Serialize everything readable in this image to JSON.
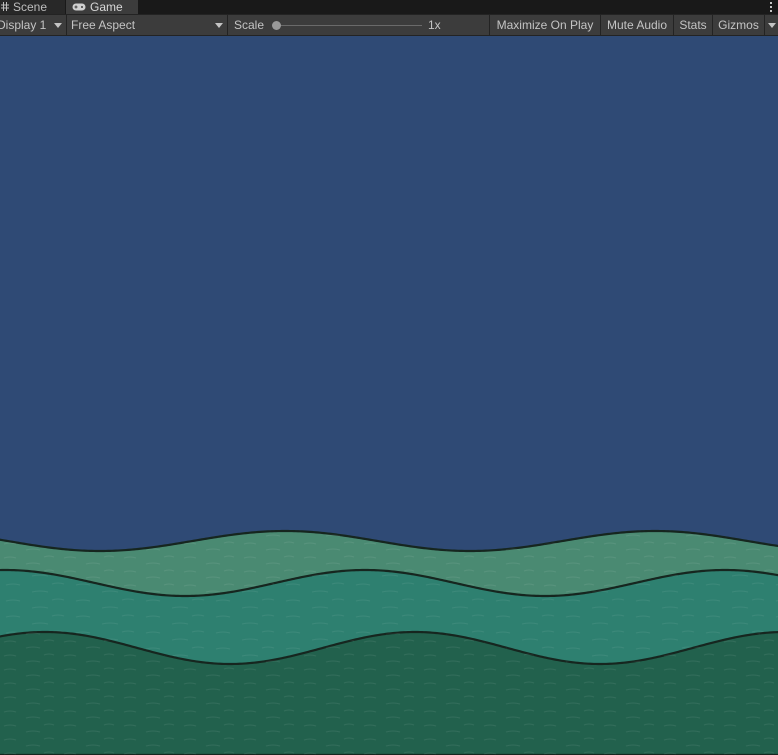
{
  "tabs": [
    {
      "label": "Scene",
      "icon": "grid-icon",
      "active": false
    },
    {
      "label": "Game",
      "icon": "gamepad-icon",
      "active": true
    }
  ],
  "toolbar": {
    "display": "Display 1",
    "aspect": "Free Aspect",
    "scale_label": "Scale",
    "scale_value": "1x",
    "maximize": "Maximize On Play",
    "mute": "Mute Audio",
    "stats": "Stats",
    "gizmos": "Gizmos"
  },
  "game": {
    "sky_color": "#2f4a75",
    "waves": [
      {
        "name": "back-wave",
        "color": "#4a8a72"
      },
      {
        "name": "middle-wave",
        "color": "#2e8070"
      },
      {
        "name": "front-wave",
        "color": "#22614d"
      }
    ],
    "outline_color": "#16261f"
  }
}
